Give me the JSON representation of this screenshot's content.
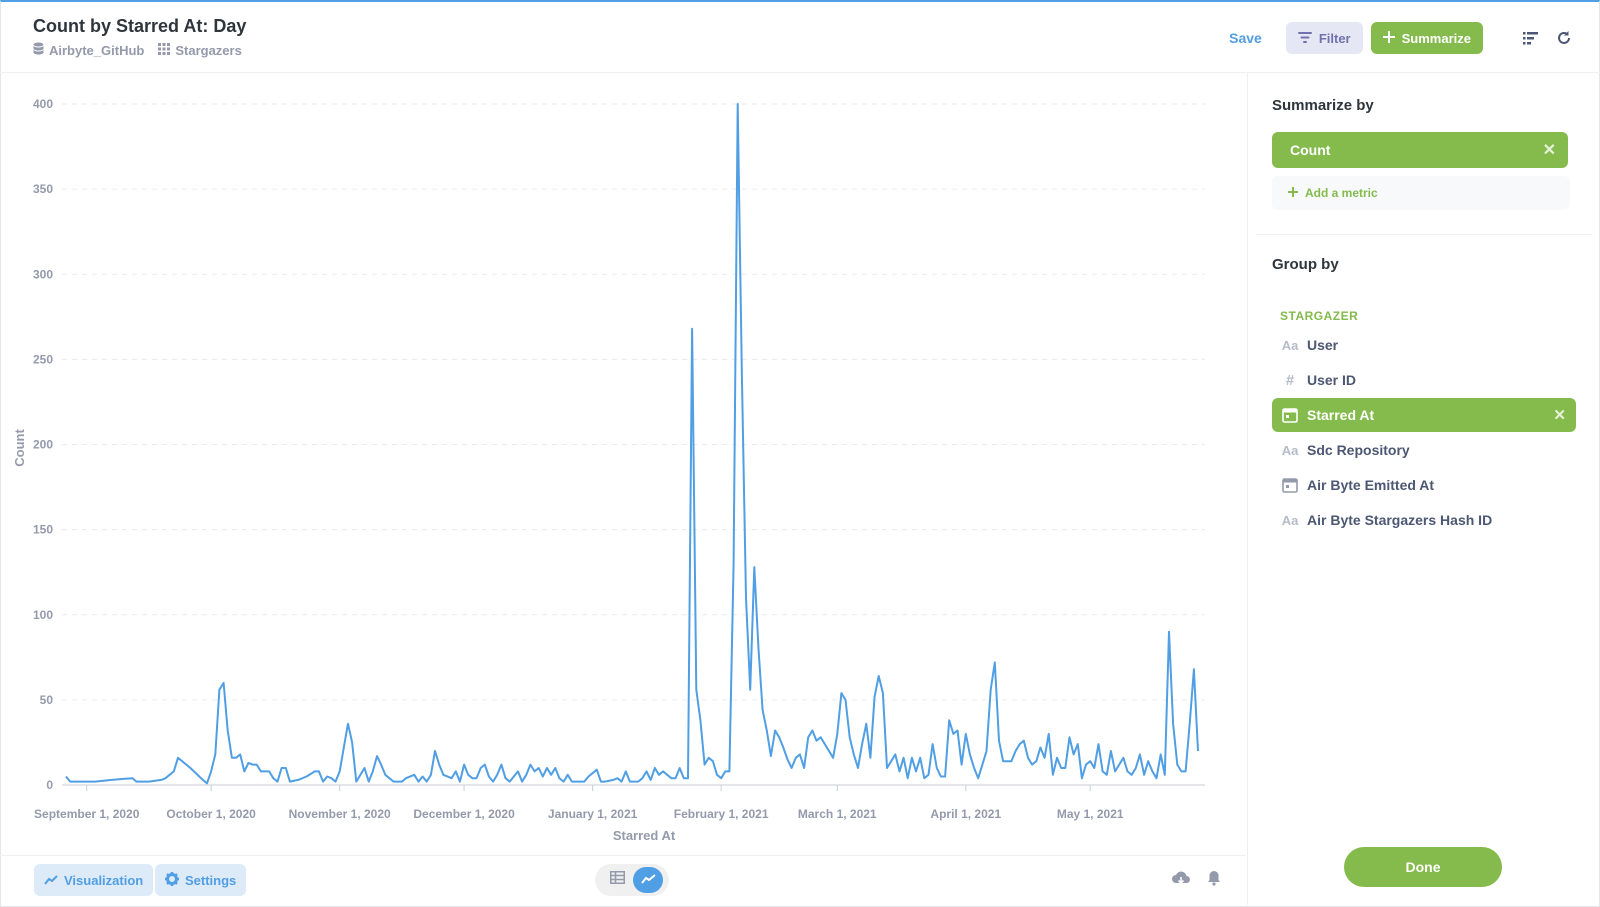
{
  "header": {
    "title": "Count by Starred At: Day",
    "breadcrumb_database": "Airbyte_GitHub",
    "breadcrumb_table": "Stargazers",
    "save_label": "Save",
    "filter_label": "Filter",
    "summarize_label": "Summarize"
  },
  "sidebar": {
    "summarize_title": "Summarize by",
    "metric_label": "Count",
    "add_metric_label": "Add a metric",
    "group_title": "Group by",
    "group_header": "STARGAZER",
    "fields": [
      {
        "label": "User",
        "icon": "text-type-icon",
        "selected": false
      },
      {
        "label": "User ID",
        "icon": "number-type-icon",
        "selected": false
      },
      {
        "label": "Starred At",
        "icon": "calendar-icon",
        "selected": true
      },
      {
        "label": "Sdc Repository",
        "icon": "text-type-icon",
        "selected": false
      },
      {
        "label": "Air Byte Emitted At",
        "icon": "calendar-icon",
        "selected": false
      },
      {
        "label": "Air Byte Stargazers Hash ID",
        "icon": "text-type-icon",
        "selected": false
      }
    ],
    "done_label": "Done"
  },
  "footer": {
    "visualization_label": "Visualization",
    "settings_label": "Settings"
  },
  "colors": {
    "accent_blue": "#509ee3",
    "summarize_green": "#84bb4c",
    "filter_purple": "#7172ad"
  },
  "chart_data": {
    "type": "line",
    "xlabel": "Starred At",
    "ylabel": "Count",
    "ylim": [
      0,
      400
    ],
    "yticks": [
      0,
      50,
      100,
      150,
      200,
      250,
      300,
      350,
      400
    ],
    "xtick_labels": [
      "September 1, 2020",
      "October 1, 2020",
      "November 1, 2020",
      "December 1, 2020",
      "January 1, 2021",
      "February 1, 2021",
      "March 1, 2021",
      "April 1, 2021",
      "May 1, 2021"
    ],
    "xtick_dates": [
      "2020-09-01",
      "2020-10-01",
      "2020-11-01",
      "2020-12-01",
      "2021-01-01",
      "2021-02-01",
      "2021-03-01",
      "2021-04-01",
      "2021-05-01"
    ],
    "xlim": [
      "2020-08-27",
      "2021-05-27"
    ],
    "grid": true,
    "series": [
      {
        "points": [
          [
            "2020-08-27",
            5
          ],
          [
            "2020-08-28",
            2
          ],
          [
            "2020-08-31",
            2
          ],
          [
            "2020-09-03",
            2
          ],
          [
            "2020-09-07",
            3
          ],
          [
            "2020-09-12",
            4
          ],
          [
            "2020-09-13",
            2
          ],
          [
            "2020-09-16",
            2
          ],
          [
            "2020-09-19",
            3
          ],
          [
            "2020-09-20",
            4
          ],
          [
            "2020-09-22",
            8
          ],
          [
            "2020-09-23",
            16
          ],
          [
            "2020-09-26",
            10
          ],
          [
            "2020-09-29",
            3
          ],
          [
            "2020-09-30",
            1
          ],
          [
            "2020-10-01",
            8
          ],
          [
            "2020-10-02",
            18
          ],
          [
            "2020-10-03",
            56
          ],
          [
            "2020-10-04",
            60
          ],
          [
            "2020-10-05",
            32
          ],
          [
            "2020-10-06",
            16
          ],
          [
            "2020-10-07",
            16
          ],
          [
            "2020-10-08",
            18
          ],
          [
            "2020-10-09",
            8
          ],
          [
            "2020-10-10",
            13
          ],
          [
            "2020-10-11",
            12
          ],
          [
            "2020-10-12",
            12
          ],
          [
            "2020-10-13",
            8
          ],
          [
            "2020-10-14",
            8
          ],
          [
            "2020-10-15",
            8
          ],
          [
            "2020-10-16",
            4
          ],
          [
            "2020-10-17",
            2
          ],
          [
            "2020-10-18",
            10
          ],
          [
            "2020-10-19",
            10
          ],
          [
            "2020-10-20",
            2
          ],
          [
            "2020-10-22",
            3
          ],
          [
            "2020-10-24",
            5
          ],
          [
            "2020-10-26",
            8
          ],
          [
            "2020-10-27",
            8
          ],
          [
            "2020-10-28",
            2
          ],
          [
            "2020-10-29",
            5
          ],
          [
            "2020-10-30",
            4
          ],
          [
            "2020-10-31",
            2
          ],
          [
            "2020-11-01",
            8
          ],
          [
            "2020-11-02",
            22
          ],
          [
            "2020-11-03",
            36
          ],
          [
            "2020-11-04",
            25
          ],
          [
            "2020-11-05",
            2
          ],
          [
            "2020-11-06",
            6
          ],
          [
            "2020-11-07",
            10
          ],
          [
            "2020-11-08",
            2
          ],
          [
            "2020-11-09",
            8
          ],
          [
            "2020-11-10",
            17
          ],
          [
            "2020-11-11",
            12
          ],
          [
            "2020-11-12",
            6
          ],
          [
            "2020-11-13",
            4
          ],
          [
            "2020-11-14",
            2
          ],
          [
            "2020-11-16",
            2
          ],
          [
            "2020-11-17",
            4
          ],
          [
            "2020-11-19",
            6
          ],
          [
            "2020-11-20",
            2
          ],
          [
            "2020-11-21",
            5
          ],
          [
            "2020-11-22",
            2
          ],
          [
            "2020-11-23",
            6
          ],
          [
            "2020-11-24",
            20
          ],
          [
            "2020-11-25",
            12
          ],
          [
            "2020-11-26",
            6
          ],
          [
            "2020-11-28",
            4
          ],
          [
            "2020-11-29",
            8
          ],
          [
            "2020-11-30",
            2
          ],
          [
            "2020-12-01",
            12
          ],
          [
            "2020-12-02",
            6
          ],
          [
            "2020-12-03",
            4
          ],
          [
            "2020-12-04",
            4
          ],
          [
            "2020-12-05",
            10
          ],
          [
            "2020-12-06",
            12
          ],
          [
            "2020-12-07",
            5
          ],
          [
            "2020-12-08",
            2
          ],
          [
            "2020-12-09",
            6
          ],
          [
            "2020-12-10",
            12
          ],
          [
            "2020-12-11",
            4
          ],
          [
            "2020-12-12",
            2
          ],
          [
            "2020-12-13",
            5
          ],
          [
            "2020-12-14",
            8
          ],
          [
            "2020-12-15",
            2
          ],
          [
            "2020-12-16",
            6
          ],
          [
            "2020-12-17",
            12
          ],
          [
            "2020-12-18",
            8
          ],
          [
            "2020-12-19",
            10
          ],
          [
            "2020-12-20",
            5
          ],
          [
            "2020-12-21",
            10
          ],
          [
            "2020-12-22",
            6
          ],
          [
            "2020-12-23",
            10
          ],
          [
            "2020-12-24",
            4
          ],
          [
            "2020-12-25",
            2
          ],
          [
            "2020-12-26",
            6
          ],
          [
            "2020-12-27",
            2
          ],
          [
            "2020-12-30",
            2
          ],
          [
            "2020-12-31",
            5
          ],
          [
            "2021-01-02",
            9
          ],
          [
            "2021-01-03",
            2
          ],
          [
            "2021-01-04",
            2
          ],
          [
            "2021-01-06",
            3
          ],
          [
            "2021-01-07",
            4
          ],
          [
            "2021-01-08",
            2
          ],
          [
            "2021-01-09",
            8
          ],
          [
            "2021-01-10",
            2
          ],
          [
            "2021-01-12",
            2
          ],
          [
            "2021-01-13",
            4
          ],
          [
            "2021-01-14",
            8
          ],
          [
            "2021-01-15",
            3
          ],
          [
            "2021-01-16",
            10
          ],
          [
            "2021-01-17",
            6
          ],
          [
            "2021-01-18",
            8
          ],
          [
            "2021-01-19",
            6
          ],
          [
            "2021-01-20",
            4
          ],
          [
            "2021-01-21",
            4
          ],
          [
            "2021-01-22",
            10
          ],
          [
            "2021-01-23",
            4
          ],
          [
            "2021-01-24",
            4
          ],
          [
            "2021-01-25",
            268
          ],
          [
            "2021-01-26",
            56
          ],
          [
            "2021-01-27",
            38
          ],
          [
            "2021-01-28",
            12
          ],
          [
            "2021-01-29",
            16
          ],
          [
            "2021-01-30",
            14
          ],
          [
            "2021-01-31",
            6
          ],
          [
            "2021-02-01",
            4
          ],
          [
            "2021-02-02",
            8
          ],
          [
            "2021-02-03",
            8
          ],
          [
            "2021-02-04",
            130
          ],
          [
            "2021-02-05",
            400
          ],
          [
            "2021-02-06",
            240
          ],
          [
            "2021-02-07",
            110
          ],
          [
            "2021-02-08",
            56
          ],
          [
            "2021-02-09",
            128
          ],
          [
            "2021-02-10",
            80
          ],
          [
            "2021-02-11",
            44
          ],
          [
            "2021-02-12",
            32
          ],
          [
            "2021-02-13",
            17
          ],
          [
            "2021-02-14",
            32
          ],
          [
            "2021-02-15",
            28
          ],
          [
            "2021-02-16",
            22
          ],
          [
            "2021-02-17",
            15
          ],
          [
            "2021-02-18",
            10
          ],
          [
            "2021-02-19",
            16
          ],
          [
            "2021-02-20",
            18
          ],
          [
            "2021-02-21",
            10
          ],
          [
            "2021-02-22",
            28
          ],
          [
            "2021-02-23",
            32
          ],
          [
            "2021-02-24",
            26
          ],
          [
            "2021-02-25",
            28
          ],
          [
            "2021-02-26",
            24
          ],
          [
            "2021-02-27",
            20
          ],
          [
            "2021-02-28",
            16
          ],
          [
            "2021-03-01",
            30
          ],
          [
            "2021-03-02",
            54
          ],
          [
            "2021-03-03",
            50
          ],
          [
            "2021-03-04",
            28
          ],
          [
            "2021-03-05",
            18
          ],
          [
            "2021-03-06",
            10
          ],
          [
            "2021-03-07",
            24
          ],
          [
            "2021-03-08",
            36
          ],
          [
            "2021-03-09",
            16
          ],
          [
            "2021-03-10",
            52
          ],
          [
            "2021-03-11",
            64
          ],
          [
            "2021-03-12",
            54
          ],
          [
            "2021-03-13",
            10
          ],
          [
            "2021-03-14",
            14
          ],
          [
            "2021-03-15",
            18
          ],
          [
            "2021-03-16",
            8
          ],
          [
            "2021-03-17",
            16
          ],
          [
            "2021-03-18",
            4
          ],
          [
            "2021-03-19",
            16
          ],
          [
            "2021-03-20",
            8
          ],
          [
            "2021-03-21",
            16
          ],
          [
            "2021-03-22",
            4
          ],
          [
            "2021-03-23",
            6
          ],
          [
            "2021-03-24",
            24
          ],
          [
            "2021-03-25",
            10
          ],
          [
            "2021-03-26",
            5
          ],
          [
            "2021-03-27",
            5
          ],
          [
            "2021-03-28",
            38
          ],
          [
            "2021-03-29",
            30
          ],
          [
            "2021-03-30",
            32
          ],
          [
            "2021-03-31",
            12
          ],
          [
            "2021-04-01",
            30
          ],
          [
            "2021-04-02",
            18
          ],
          [
            "2021-04-03",
            10
          ],
          [
            "2021-04-04",
            4
          ],
          [
            "2021-04-05",
            12
          ],
          [
            "2021-04-06",
            20
          ],
          [
            "2021-04-07",
            56
          ],
          [
            "2021-04-08",
            72
          ],
          [
            "2021-04-09",
            26
          ],
          [
            "2021-04-10",
            14
          ],
          [
            "2021-04-11",
            14
          ],
          [
            "2021-04-12",
            14
          ],
          [
            "2021-04-13",
            20
          ],
          [
            "2021-04-14",
            24
          ],
          [
            "2021-04-15",
            26
          ],
          [
            "2021-04-16",
            16
          ],
          [
            "2021-04-17",
            12
          ],
          [
            "2021-04-18",
            14
          ],
          [
            "2021-04-19",
            22
          ],
          [
            "2021-04-20",
            16
          ],
          [
            "2021-04-21",
            30
          ],
          [
            "2021-04-22",
            6
          ],
          [
            "2021-04-23",
            16
          ],
          [
            "2021-04-24",
            10
          ],
          [
            "2021-04-25",
            10
          ],
          [
            "2021-04-26",
            28
          ],
          [
            "2021-04-27",
            18
          ],
          [
            "2021-04-28",
            24
          ],
          [
            "2021-04-29",
            4
          ],
          [
            "2021-04-30",
            12
          ],
          [
            "2021-05-01",
            14
          ],
          [
            "2021-05-02",
            10
          ],
          [
            "2021-05-03",
            24
          ],
          [
            "2021-05-04",
            8
          ],
          [
            "2021-05-05",
            6
          ],
          [
            "2021-05-06",
            20
          ],
          [
            "2021-05-07",
            8
          ],
          [
            "2021-05-08",
            12
          ],
          [
            "2021-05-09",
            16
          ],
          [
            "2021-05-10",
            8
          ],
          [
            "2021-05-11",
            6
          ],
          [
            "2021-05-12",
            10
          ],
          [
            "2021-05-13",
            18
          ],
          [
            "2021-05-14",
            6
          ],
          [
            "2021-05-15",
            14
          ],
          [
            "2021-05-16",
            8
          ],
          [
            "2021-05-17",
            4
          ],
          [
            "2021-05-18",
            18
          ],
          [
            "2021-05-19",
            6
          ],
          [
            "2021-05-20",
            90
          ],
          [
            "2021-05-21",
            36
          ],
          [
            "2021-05-22",
            12
          ],
          [
            "2021-05-23",
            8
          ],
          [
            "2021-05-24",
            8
          ],
          [
            "2021-05-25",
            36
          ],
          [
            "2021-05-26",
            68
          ],
          [
            "2021-05-27",
            20
          ]
        ]
      }
    ]
  }
}
